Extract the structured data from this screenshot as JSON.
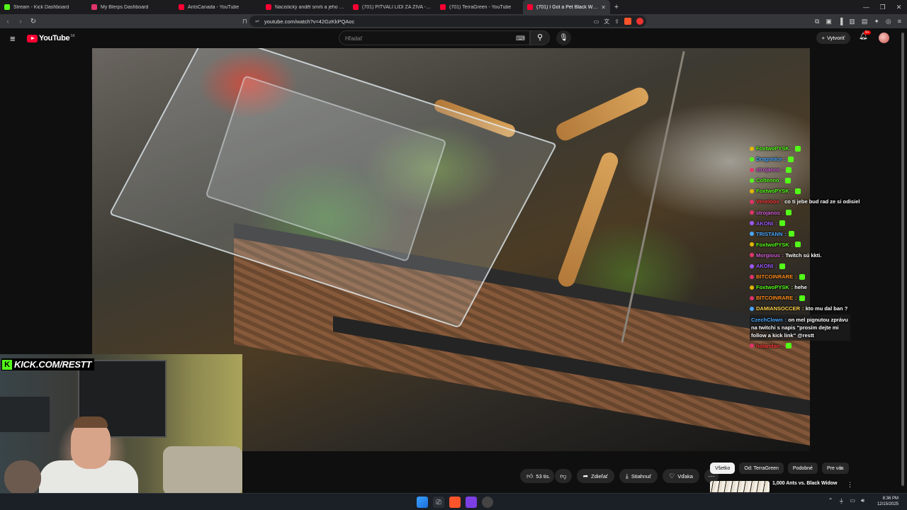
{
  "tabs": [
    {
      "title": "Stream - Kick Dashboard",
      "favicon_color": "#53fc18"
    },
    {
      "title": "My Blerps Dashboard",
      "favicon_color": "#e2336b"
    },
    {
      "title": "AntsCanada - YouTube",
      "favicon_color": "#ff0033"
    },
    {
      "title": "Nacistický anděl smrti a jeho strašliv",
      "favicon_color": "#ff0033"
    },
    {
      "title": "(701) PITVALI LIDI ZA ŽIVA - Jednotk",
      "favicon_color": "#ff0033"
    },
    {
      "title": "(701) TerraGreen - YouTube",
      "favicon_color": "#ff0033"
    },
    {
      "title": "(701) I Got a Pet Black Widow",
      "favicon_color": "#ff0033",
      "active": true
    }
  ],
  "address": {
    "url": "youtube.com/watch?v=42GzKkPQAoc"
  },
  "youtube": {
    "logo_text": "YouTube",
    "logo_country": "SK",
    "search_placeholder": "Hľadať",
    "create_label": "Vytvoriť",
    "notif_count": "9+"
  },
  "overlay": {
    "kick_label": "KICK.COM/RESTT"
  },
  "chat": [
    {
      "user": "FoxtwoPYSK",
      "msg": "",
      "color": "#53fc18",
      "badge": "#e2b700"
    },
    {
      "user": "Dragonice",
      "msg": "",
      "color": "#4aa8ff",
      "badge": "#53fc18"
    },
    {
      "user": "strojanos",
      "msg": "",
      "color": "#d25fd6",
      "badge": "#e2336b"
    },
    {
      "user": "Coltenno",
      "msg": "",
      "color": "#53fc18",
      "badge": "#53fc18"
    },
    {
      "user": "FoxtwoPYSK",
      "msg": "",
      "color": "#53fc18",
      "badge": "#e2b700"
    },
    {
      "user": "Veseloox",
      "msg": "co ti jebe bud rad ze si odisiel",
      "color": "#ff3a3a",
      "badge": "#e2336b"
    },
    {
      "user": "strojanos",
      "msg": "",
      "color": "#d25fd6",
      "badge": "#e2336b"
    },
    {
      "user": "AKONI",
      "msg": "",
      "color": "#9b59ff",
      "badge": "#9b59ff"
    },
    {
      "user": "TRISTANN",
      "msg": "",
      "color": "#4aa8ff",
      "badge": "#4aa8ff"
    },
    {
      "user": "FoxtwoPYSK",
      "msg": "",
      "color": "#53fc18",
      "badge": "#e2b700"
    },
    {
      "user": "Morgious",
      "msg": "Twitch sú kkti.",
      "color": "#d25fd6",
      "badge": "#e2336b"
    },
    {
      "user": "AKONI",
      "msg": "",
      "color": "#9b59ff",
      "badge": "#9b59ff"
    },
    {
      "user": "BITCOINRARE",
      "msg": "",
      "color": "#ff8c1a",
      "badge": "#e2336b"
    },
    {
      "user": "FoxtwoPYSK",
      "msg": "hehe",
      "color": "#53fc18",
      "badge": "#e2b700"
    },
    {
      "user": "BITCOINRARE",
      "msg": "",
      "color": "#ff8c1a",
      "badge": "#e2336b"
    },
    {
      "user": "DAMIANSOCCER",
      "msg": "kto mu dal ban ?",
      "color": "#ffd34a",
      "badge": "#4aa8ff"
    },
    {
      "user": "CzechClown",
      "msg": "on mel pignutou zprávu na twitchi s napis \"prosím dejte mi follow a kick link\" @restt",
      "color": "#4aa8ff",
      "badge": "",
      "wrap": true
    },
    {
      "user": "holandan",
      "msg": "",
      "color": "#ff3a3a",
      "badge": "#e2336b"
    }
  ],
  "actions": {
    "like_count": "53 tis.",
    "share": "Zdieľať",
    "download": "Stiahnuť",
    "thanks": "Vďaka"
  },
  "filters": [
    "Všetko",
    "Od: TerraGreen",
    "Podobné",
    "Pre vás"
  ],
  "recommendation": {
    "title": "1,000 Ants vs. Black Widow"
  },
  "taskbar": {
    "time": "8:36 PM",
    "date": "12/15/2025"
  },
  "colors": {
    "yt_red": "#ff0033",
    "kick_green": "#53fc18",
    "bg": "#0f0f0f"
  }
}
